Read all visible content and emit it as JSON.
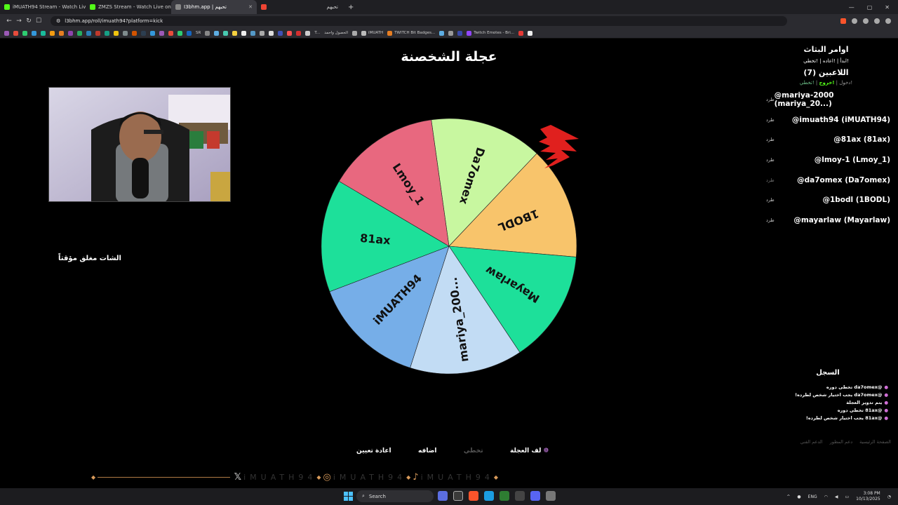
{
  "browser": {
    "tabs": [
      {
        "title": "iMUATH94 Stream - Watch Live o",
        "icon": "kick-icon",
        "active": false
      },
      {
        "title": "ZMZS Stream - Watch Live on Kick",
        "icon": "kick-icon",
        "active": false
      },
      {
        "title": "I3bhm.app | تحبهم",
        "icon": "tab-icon",
        "active": true
      },
      {
        "title": "تحبهم",
        "icon": "tab-icon",
        "active": false
      }
    ],
    "url": "l3bhm.app/roll/imuath94?platform=kick",
    "bookmarks": [
      "SR",
      "T...",
      "الحصول واحمد",
      "iMUATH",
      "TWITCH Bit Badges...",
      "Twitch Emotes - Bri..."
    ]
  },
  "page": {
    "title": "عجلة الشخصنة",
    "chat_closed": "الشات مغلق مؤقتاً",
    "wheel": {
      "segments": [
        {
          "label": "Da7omex",
          "color": "#c8f7a0"
        },
        {
          "label": "1BODL",
          "color": "#f8c46b"
        },
        {
          "label": "Mayarlaw",
          "color": "#1de09a"
        },
        {
          "label": "mariya_200...",
          "color": "#c2dcf4"
        },
        {
          "label": "iMUATH94",
          "color": "#76aee8"
        },
        {
          "label": "81ax",
          "color": "#1de09a"
        },
        {
          "label": "Lmoy_1",
          "color": "#e8687f"
        }
      ]
    },
    "sidebar": {
      "title": "اوامر البثاث",
      "commands": "!ابدأ | !اعاده | !تخطي",
      "players_title": "اللاعبين (7)",
      "legend_enter": "!دخول",
      "legend_exit": "!خروج",
      "legend_skip": "!تخطي",
      "kick_label": "طرد",
      "players": [
        {
          "name": "@mariya-2000 (mariya_20...)"
        },
        {
          "name": "@imuath94 (iMUATH94)"
        },
        {
          "name": "@81ax (81ax)"
        },
        {
          "name": "@lmoy-1 (Lmoy_1)"
        },
        {
          "name": "@da7omex (Da7omex)"
        },
        {
          "name": "@1bodl (1BODL)"
        },
        {
          "name": "@mayarlaw (Mayarlaw)"
        }
      ]
    },
    "log": {
      "title": "السجل",
      "lines": [
        "@da7omex تخطى دوره",
        "@da7omex يجب اختيار شخص لطرده!",
        "يتم تدوير العجلة",
        "@81ax تخطى دوره",
        "@81ax يجب اختيار شخص لطرده!"
      ]
    },
    "footer_links": [
      "الصفحة الرئيسية",
      "دعم المطور",
      "الدعم الفني"
    ],
    "controls": {
      "spin": "لف العجلة",
      "skip": "تخطي",
      "add": "اضافه",
      "reset": "اعادة تعيين"
    },
    "social_handle": "iMUATH94"
  },
  "taskbar": {
    "search_placeholder": "Search",
    "lang": "ENG",
    "time": "3:08 PM",
    "date": "10/13/2025"
  },
  "colors": {
    "accent_kick": "#53fc18",
    "pointer": "#e0201e"
  }
}
